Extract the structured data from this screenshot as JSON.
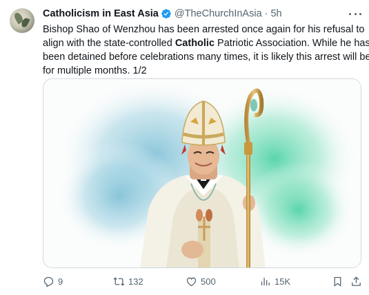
{
  "tweet": {
    "display_name": "Catholicism in East Asia",
    "handle": "@TheChurchInAsia",
    "separator": "·",
    "time": "5h",
    "text": {
      "line1": "Bishop Shao of Wenzhou has been arrested once again for his refusal to",
      "line2_pre": "align with the state-controlled ",
      "line2_bold": "Catholic",
      "line2_post": " Patriotic Association. While he has",
      "line3": "been detained before celebrations many times, it is likely this arrest will be",
      "line4": "for multiple months. 1/2"
    },
    "verified": true
  },
  "actions": {
    "replies": "9",
    "retweets": "132",
    "likes": "500",
    "views": "15K"
  },
  "icons": {
    "verified": "verified-badge-icon",
    "more": "more-options-icon",
    "reply": "reply-icon",
    "retweet": "retweet-icon",
    "like": "heart-icon",
    "views": "views-chart-icon",
    "bookmark": "bookmark-icon",
    "share": "share-icon"
  },
  "colors": {
    "text": "#0f1419",
    "secondary": "#536471",
    "verified": "#1d9bf0",
    "border": "#cfd9de"
  }
}
